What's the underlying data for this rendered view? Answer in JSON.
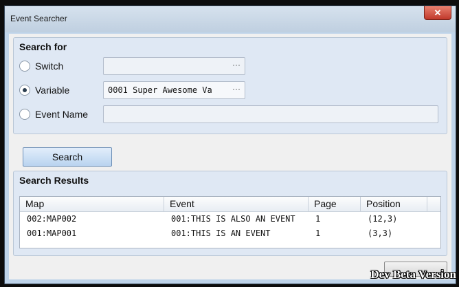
{
  "window": {
    "title": "Event Searcher",
    "close_glyph": "✕"
  },
  "search_for": {
    "heading": "Search for",
    "switch_label": "Switch",
    "switch_value": "",
    "variable_label": "Variable",
    "variable_value": "0001 Super Awesome Va",
    "event_name_label": "Event Name",
    "event_name_value": "",
    "picker_dots": "···",
    "selected": "variable"
  },
  "search_button": "Search",
  "results": {
    "heading": "Search Results",
    "columns": [
      "Map",
      "Event",
      "Page",
      "Position"
    ],
    "rows": [
      {
        "map": "002:MAP002",
        "event": "001:THIS IS ALSO AN EVENT",
        "page": "1",
        "position": "(12,3)"
      },
      {
        "map": "001:MAP001",
        "event": "001:THIS IS AN EVENT",
        "page": "1",
        "position": "(3,3)"
      }
    ]
  },
  "watermark": "Dev Beta Version"
}
